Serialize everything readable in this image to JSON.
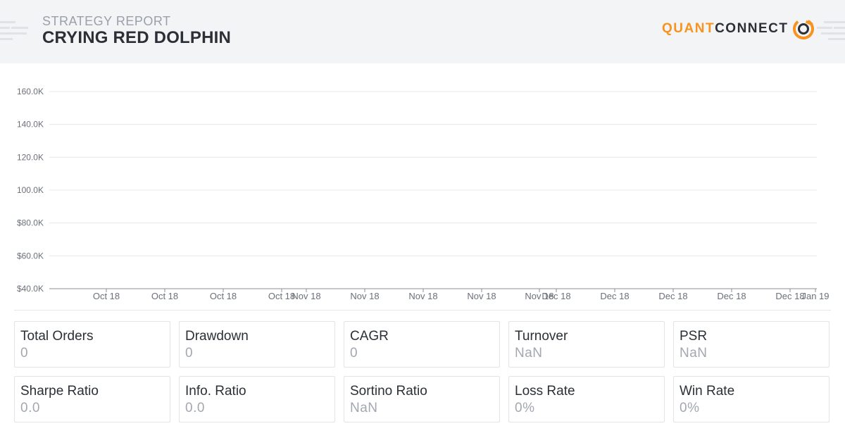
{
  "header": {
    "subtitle": "STRATEGY REPORT",
    "title": "CRYING RED DOLPHIN",
    "logo": {
      "part1": "QUANT",
      "part2": "CONNECT",
      "mark_icon": "quantconnect-logo-icon"
    }
  },
  "colors": {
    "header_bg": "#f3f4f6",
    "brand_orange": "#f7931e",
    "title_dark": "#2b2f36",
    "muted": "#a2a7b0",
    "grid": "#e6e8eb"
  },
  "chart_data": {
    "type": "line",
    "title": "",
    "xlabel": "",
    "ylabel": "",
    "y_ticks": [
      "160.0K",
      "140.0K",
      "120.0K",
      "100.0K",
      "$80.0K",
      "$60.0K",
      "$40.0K"
    ],
    "ylim": [
      40000,
      160000
    ],
    "x_ticks": [
      "Oct 18",
      "Oct 18",
      "Oct 18",
      "Oct 18",
      "Nov 18",
      "Nov 18",
      "Nov 18",
      "Nov 18",
      "Nov 18",
      "Dec 18",
      "Dec 18",
      "Dec 18",
      "Dec 18",
      "Dec 18",
      "Jan 19"
    ],
    "series": [],
    "grid": true
  },
  "metrics": [
    {
      "label": "Total Orders",
      "value": "0"
    },
    {
      "label": "Drawdown",
      "value": "0"
    },
    {
      "label": "CAGR",
      "value": "0"
    },
    {
      "label": "Turnover",
      "value": "NaN"
    },
    {
      "label": "PSR",
      "value": "NaN"
    },
    {
      "label": "Sharpe Ratio",
      "value": "0.0"
    },
    {
      "label": "Info. Ratio",
      "value": "0.0"
    },
    {
      "label": "Sortino Ratio",
      "value": "NaN"
    },
    {
      "label": "Loss Rate",
      "value": "0%"
    },
    {
      "label": "Win Rate",
      "value": "0%"
    }
  ]
}
